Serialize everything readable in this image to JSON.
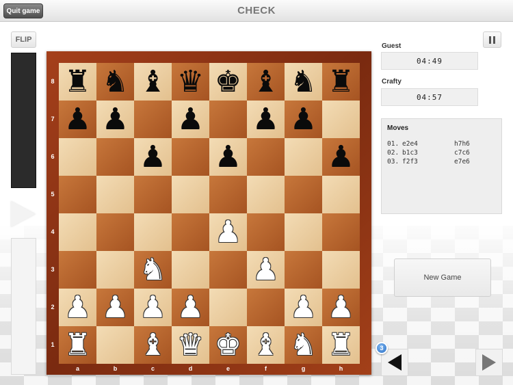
{
  "header": {
    "quit_label": "Quit game",
    "title": "CHECK"
  },
  "controls": {
    "flip_label": "FLIP",
    "new_game_label": "New Game",
    "move_count_badge": "3"
  },
  "players": [
    {
      "name": "Guest",
      "clock": "04:49"
    },
    {
      "name": "Crafty",
      "clock": "04:57"
    }
  ],
  "moves": {
    "title": "Moves",
    "list": [
      {
        "num": "01.",
        "white": "e2e4",
        "black": "h7h6"
      },
      {
        "num": "02.",
        "white": "b1c3",
        "black": "c7c6"
      },
      {
        "num": "03.",
        "white": "f2f3",
        "black": "e7e6"
      }
    ]
  },
  "board": {
    "files": [
      "a",
      "b",
      "c",
      "d",
      "e",
      "f",
      "g",
      "h"
    ],
    "ranks": [
      "8",
      "7",
      "6",
      "5",
      "4",
      "3",
      "2",
      "1"
    ],
    "position": [
      [
        "br",
        "bn",
        "bb",
        "bq",
        "bk",
        "bb",
        "bn",
        "br"
      ],
      [
        "bp",
        "bp",
        "",
        "bp",
        "",
        "bp",
        "bp",
        ""
      ],
      [
        "",
        "",
        "bp",
        "",
        "bp",
        "",
        "",
        "bp"
      ],
      [
        "",
        "",
        "",
        "",
        "",
        "",
        "",
        ""
      ],
      [
        "",
        "",
        "",
        "",
        "wp",
        "",
        "",
        ""
      ],
      [
        "",
        "",
        "wn",
        "",
        "",
        "wp",
        "",
        ""
      ],
      [
        "wp",
        "wp",
        "wp",
        "wp",
        "",
        "",
        "wp",
        "wp"
      ],
      [
        "wr",
        "",
        "wb",
        "wq",
        "wk",
        "wb",
        "wn",
        "wr"
      ]
    ],
    "light_color": "#ecd0a4",
    "dark_color": "#b8652e",
    "frame_color": "#8f3514"
  },
  "icons": {
    "pause": "pause-icon",
    "prev": "arrow-left-icon",
    "next": "arrow-right-icon",
    "turn": "turn-indicator-icon"
  }
}
